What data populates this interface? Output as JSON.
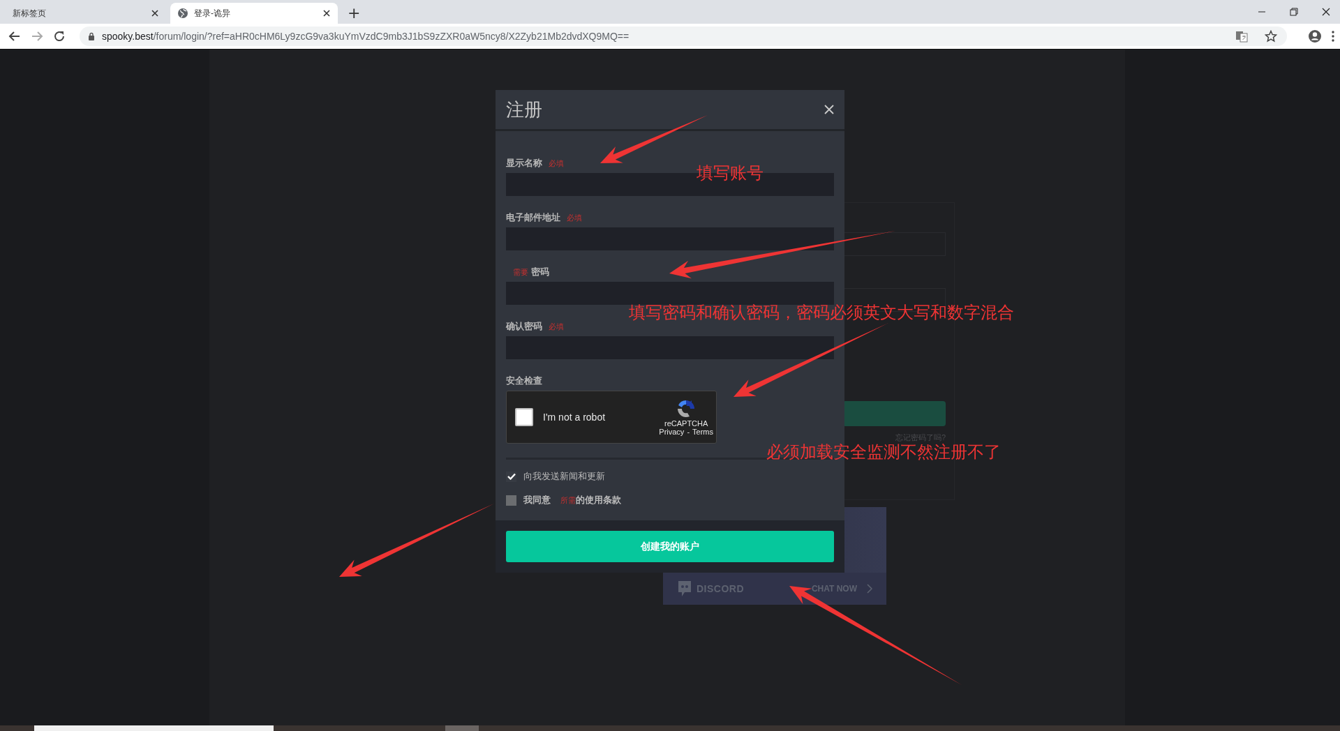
{
  "browser": {
    "tabs": [
      {
        "title": "新标签页",
        "selected": false
      },
      {
        "title": "登录-诡异",
        "selected": true
      }
    ],
    "new_tab": "+",
    "url": {
      "host": "spooky.best",
      "path": "/forum/login/?ref=aHR0cHM6Ly9zcG9va3kuYmVzdC9mb3J1bS9zZXR0aW5ncy8/X2Zyb21Mb2dvdXQ9MQ=="
    }
  },
  "background": {
    "forgot_password": "忘记密码了吗?",
    "discord": {
      "brand": "DISCORD",
      "action": "CHAT NOW"
    }
  },
  "modal": {
    "title": "注册",
    "fields": [
      {
        "kind": "label_first",
        "label": "显示名称",
        "tag": "必填"
      },
      {
        "kind": "label_first",
        "label": "电子邮件地址",
        "tag": "必填"
      },
      {
        "kind": "tag_first",
        "label": "密码",
        "tag": "需要"
      },
      {
        "kind": "label_first",
        "label": "确认密码",
        "tag": "必填"
      }
    ],
    "security": {
      "label": "安全检查",
      "captcha": {
        "checked": false,
        "text": "I'm not a robot",
        "brand": "reCAPTCHA",
        "links": [
          "Privacy",
          "Terms"
        ],
        "separator": "-"
      }
    },
    "options": [
      {
        "kind": "plain",
        "label": "向我发送新闻和更新",
        "checked": true
      },
      {
        "kind": "terms",
        "label": "我同意",
        "required": "所需",
        "link": "的使用条款",
        "checked": false
      }
    ],
    "submit": "创建我的账户"
  },
  "annotations": [
    {
      "text": "填写账号"
    },
    {
      "text": "填写密码和确认密码，密码必须英文大写和数字混合"
    },
    {
      "text": "必须加载安全监测不然注册不了"
    }
  ]
}
